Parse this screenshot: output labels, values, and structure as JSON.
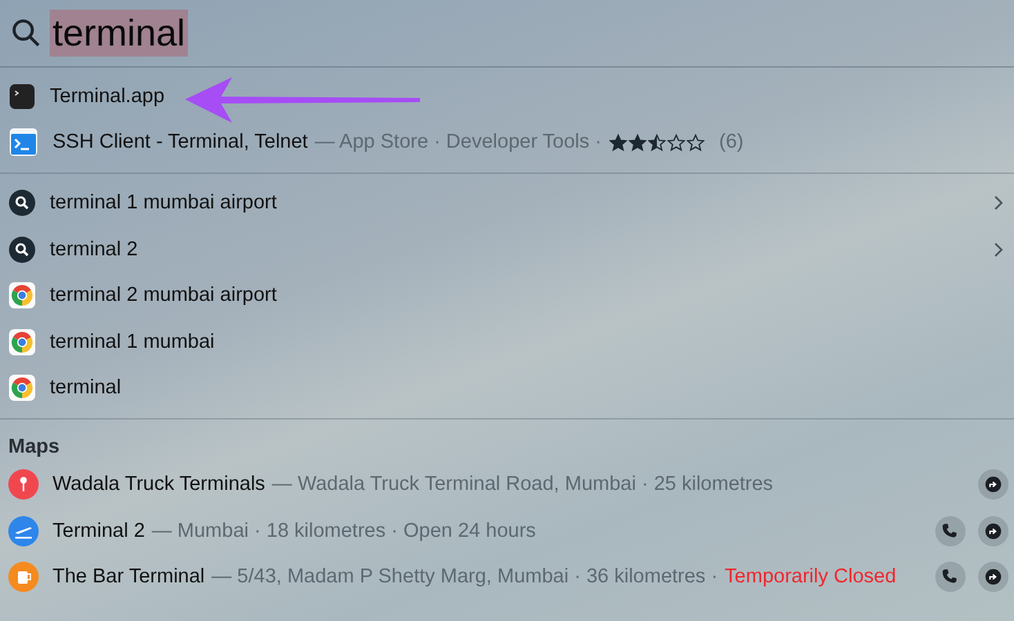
{
  "search": {
    "value": "terminal"
  },
  "top_hits": [
    {
      "kind": "terminal",
      "title": "Terminal.app"
    },
    {
      "kind": "appstore",
      "title": "SSH Client - Terminal, Telnet",
      "subtitle": "— App Store · Developer Tools ·",
      "stars": 2.5,
      "rating_count": "(6)"
    }
  ],
  "suggestions": [
    {
      "kind": "search",
      "text": "terminal 1 mumbai airport",
      "has_more": true
    },
    {
      "kind": "search",
      "text": "terminal 2",
      "has_more": true
    },
    {
      "kind": "browser",
      "text": "terminal 2 mumbai airport",
      "has_more": false
    },
    {
      "kind": "browser",
      "text": "terminal 1 mumbai",
      "has_more": false
    },
    {
      "kind": "browser",
      "text": "terminal",
      "has_more": false
    }
  ],
  "maps": {
    "heading": "Maps",
    "places": [
      {
        "kind": "pin",
        "color": "#f0474f",
        "name": "Wadala Truck Terminals",
        "detail": "— Wadala Truck Terminal Road, Mumbai · 25 kilometres",
        "call": false,
        "directions": true
      },
      {
        "kind": "airport",
        "color": "#2f86ea",
        "name": "Terminal 2",
        "detail": "— Mumbai · 18 kilometres · Open 24 hours",
        "call": true,
        "directions": true
      },
      {
        "kind": "bar",
        "color": "#f58a1f",
        "name": "The Bar Terminal",
        "detail": "— 5/43, Madam P Shetty Marg, Mumbai · 36 kilometres ·",
        "alert": "Temporarily Closed",
        "call": true,
        "directions": true
      }
    ]
  }
}
